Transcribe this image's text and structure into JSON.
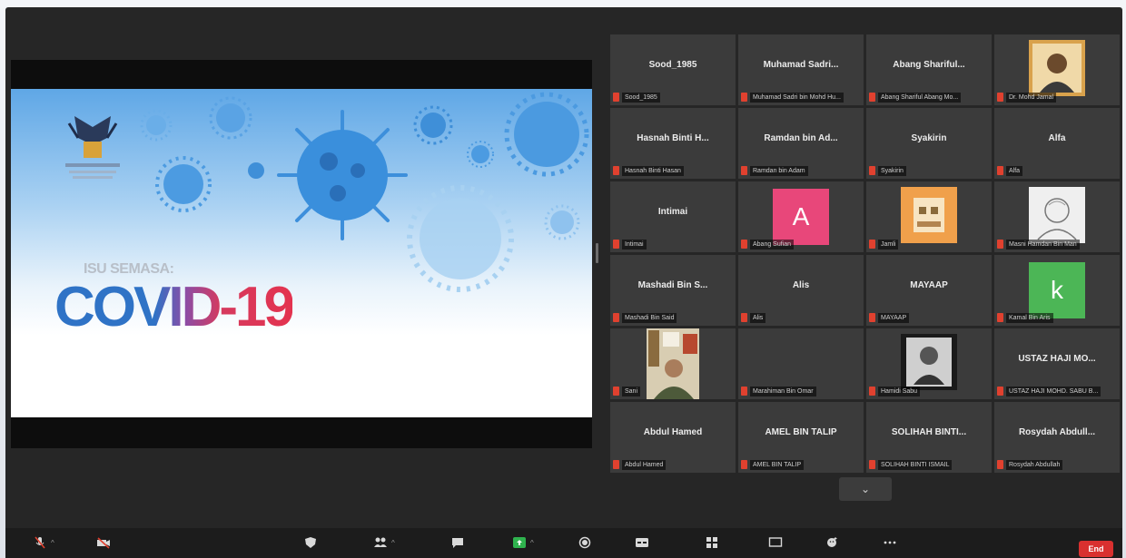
{
  "slide": {
    "subtitle": "ISU SEMASA:",
    "title": "COVID-19"
  },
  "participants": [
    {
      "name": "Sood_1985",
      "label": "Sood_1985",
      "avatar": null
    },
    {
      "name": "Muhamad Sadri...",
      "label": "Muhamad Sadri bin Mohd Hu...",
      "avatar": null
    },
    {
      "name": "Abang Shariful...",
      "label": "Abang Shariful Abang Mo...",
      "avatar": null
    },
    {
      "name": "",
      "label": "Dr. Mohd Jamal",
      "avatar": "photo-portrait"
    },
    {
      "name": "Hasnah Binti H...",
      "label": "Hasnah Binti Hasan",
      "avatar": null
    },
    {
      "name": "Ramdan bin Ad...",
      "label": "Ramdan bin Adam",
      "avatar": null
    },
    {
      "name": "Syakirin",
      "label": "Syakirin",
      "avatar": null
    },
    {
      "name": "Alfa",
      "label": "Alfa",
      "avatar": null
    },
    {
      "name": "Intimai",
      "label": "Intimai",
      "avatar": null
    },
    {
      "name": "",
      "label": "Abang Sufian",
      "avatar": "letter",
      "letter": "A",
      "color": "#e8477a"
    },
    {
      "name": "",
      "label": "Jamli",
      "avatar": "photo-orange"
    },
    {
      "name": "",
      "label": "Masni Hamdan Bin Man",
      "avatar": "photo-sketch"
    },
    {
      "name": "Mashadi Bin S...",
      "label": "Mashadi Bin Said",
      "avatar": null
    },
    {
      "name": "Alis",
      "label": "Alis",
      "avatar": null
    },
    {
      "name": "MAYAAP",
      "label": "MAYAAP",
      "avatar": null
    },
    {
      "name": "",
      "label": "Kamal Bin Aris",
      "avatar": "letter",
      "letter": "k",
      "color": "#4cb656"
    },
    {
      "name": "",
      "label": "Sani",
      "avatar": "video-person"
    },
    {
      "name": "",
      "label": "Marahiman Bin Omar",
      "avatar": null
    },
    {
      "name": "",
      "label": "Hamidi Sabu",
      "avatar": "photo-bw"
    },
    {
      "name": "USTAZ HAJI MO...",
      "label": "USTAZ HAJI MOHD. SABU B...",
      "avatar": null
    },
    {
      "name": "Abdul Hamed",
      "label": "Abdul Hamed",
      "avatar": null
    },
    {
      "name": "AMEL BIN TALIP",
      "label": "AMEL BIN TALIP",
      "avatar": null
    },
    {
      "name": "SOLIHAH BINTI...",
      "label": "SOLIHAH BINTI ISMAIL",
      "avatar": null
    },
    {
      "name": "Rosydah Abdull...",
      "label": "Rosydah Abdullah",
      "avatar": null
    }
  ],
  "pager_arrow": "⌄",
  "toolbar": {
    "end_label": "End"
  }
}
